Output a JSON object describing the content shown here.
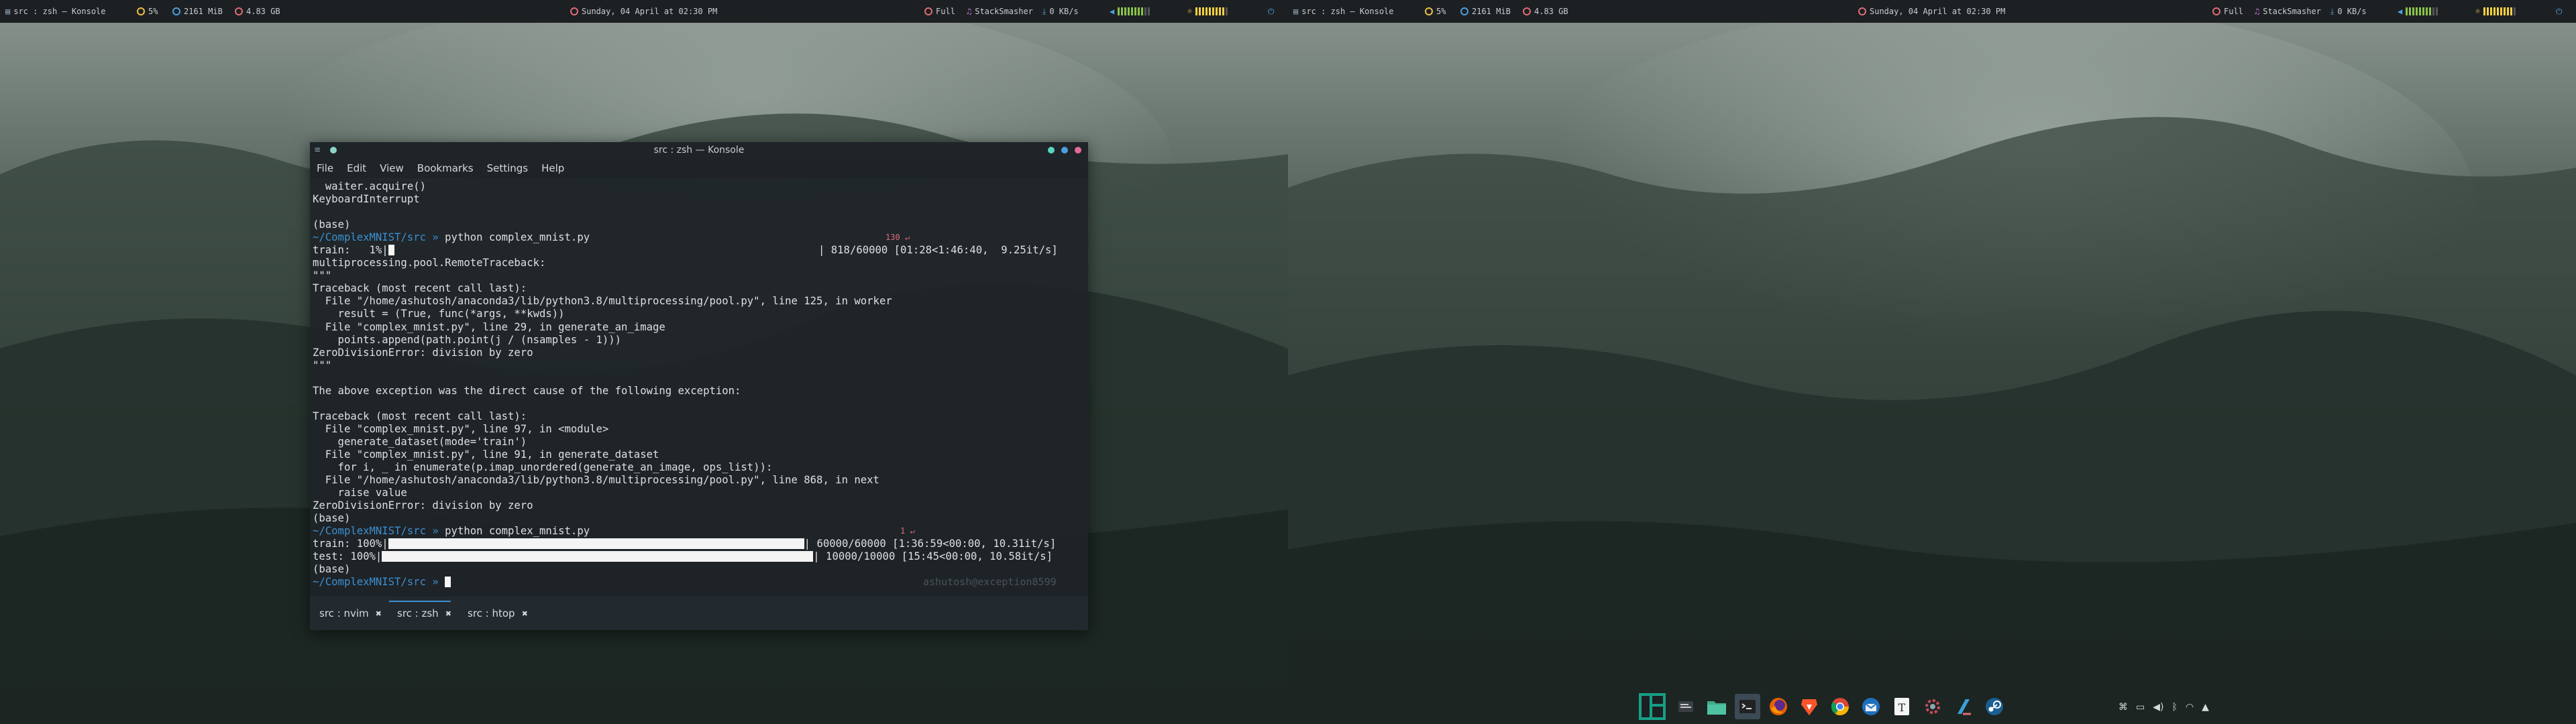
{
  "top_bar": {
    "workspace": "src : zsh — Konsole",
    "cpu": "5%",
    "memory": "2161 MiB",
    "disk": "4.83 GB",
    "datetime": "Sunday, 04 April at 02:30 PM",
    "battery": "Full",
    "music": "StackSmasher",
    "network": "0 KB/s",
    "icons": [
      "terminal-icon",
      "cpu-icon",
      "memory-icon",
      "disk-icon",
      "clock-icon",
      "battery-icon",
      "music-icon",
      "download-icon",
      "volume-icon",
      "brightness-icon",
      "power-icon"
    ]
  },
  "window": {
    "title": "src : zsh — Konsole",
    "menu": [
      "File",
      "Edit",
      "View",
      "Bookmarks",
      "Settings",
      "Help"
    ]
  },
  "terminal": {
    "prompt_dir": "~/ComplexMNIST/src",
    "prompt_symbol": "»",
    "lines": {
      "l01": "  waiter.acquire()",
      "l02": "KeyboardInterrupt",
      "l03": "",
      "l04": "(base)",
      "l05_cmd": "python complex_mnist.py",
      "l05_status": "130 ↵",
      "l06_left": "train:   1%|",
      "l06_right": "| 818/60000 [01:28<1:46:40,  9.25it/s]",
      "l07": "multiprocessing.pool.RemoteTraceback:",
      "l08": "\"\"\"",
      "l09": "Traceback (most recent call last):",
      "l10": "  File \"/home/ashutosh/anaconda3/lib/python3.8/multiprocessing/pool.py\", line 125, in worker",
      "l11": "    result = (True, func(*args, **kwds))",
      "l12": "  File \"complex_mnist.py\", line 29, in generate_an_image",
      "l13": "    points.append(path.point(j / (nsamples - 1)))",
      "l14": "ZeroDivisionError: division by zero",
      "l15": "\"\"\"",
      "l16": "",
      "l17": "The above exception was the direct cause of the following exception:",
      "l18": "",
      "l19": "Traceback (most recent call last):",
      "l20": "  File \"complex_mnist.py\", line 97, in <module>",
      "l21": "    generate_dataset(mode='train')",
      "l22": "  File \"complex_mnist.py\", line 91, in generate_dataset",
      "l23": "    for i, _ in enumerate(p.imap_unordered(generate_an_image, ops_list)):",
      "l24": "  File \"/home/ashutosh/anaconda3/lib/python3.8/multiprocessing/pool.py\", line 868, in next",
      "l25": "    raise value",
      "l26": "ZeroDivisionError: division by zero",
      "l27": "(base)",
      "l28_cmd": "python complex_mnist.py",
      "l28_status": "1 ↵",
      "l29_left": "train: 100%|",
      "l29_right": "| 60000/60000 [1:36:59<00:00, 10.31it/s]",
      "l30_left": "test: 100%|",
      "l30_right": "| 10000/10000 [15:45<00:00, 10.58it/s]",
      "l31": "(base)",
      "ghost": "ashutosh@exception8599"
    },
    "progress": {
      "train_first": 0.01,
      "train_second": 1.0,
      "test": 1.0
    }
  },
  "tabs": [
    {
      "label": "src : nvim",
      "close": "✖"
    },
    {
      "label": "src : zsh",
      "close": "✖"
    },
    {
      "label": "src : htop",
      "close": "✖"
    }
  ],
  "dock": {
    "icons": [
      "manjaro-icon",
      "files-icon",
      "folder-icon",
      "terminal-icon",
      "firefox-icon",
      "brave-icon",
      "chrome-icon",
      "thunderbird-icon",
      "typora-icon",
      "settings-icon",
      "editor-icon",
      "steam-icon"
    ]
  },
  "tray": {
    "icons": [
      "clipboard-icon",
      "storage-icon",
      "volume-icon",
      "bluetooth-icon",
      "wifi-icon",
      "expand-icon"
    ]
  },
  "colors": {
    "accent": "#3d8fd1",
    "error": "#e06c75",
    "bar_green": "#8bc34a",
    "bar_yellow": "#f4d03f"
  }
}
